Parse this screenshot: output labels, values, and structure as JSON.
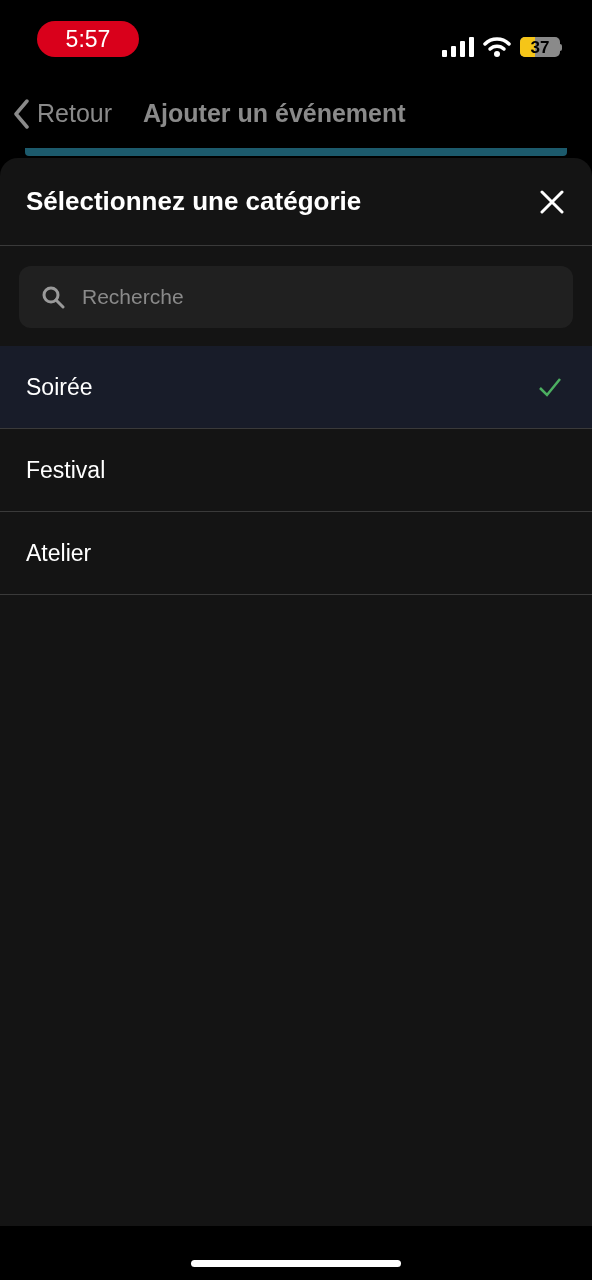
{
  "status_bar": {
    "time": "5:57",
    "battery": "37"
  },
  "nav": {
    "back": "Retour",
    "title": "Ajouter un événement"
  },
  "sheet": {
    "title": "Sélectionnez une catégorie",
    "search": {
      "placeholder": "Recherche"
    },
    "items": [
      {
        "label": "Soirée",
        "selected": true
      },
      {
        "label": "Festival",
        "selected": false
      },
      {
        "label": "Atelier",
        "selected": false
      }
    ]
  }
}
